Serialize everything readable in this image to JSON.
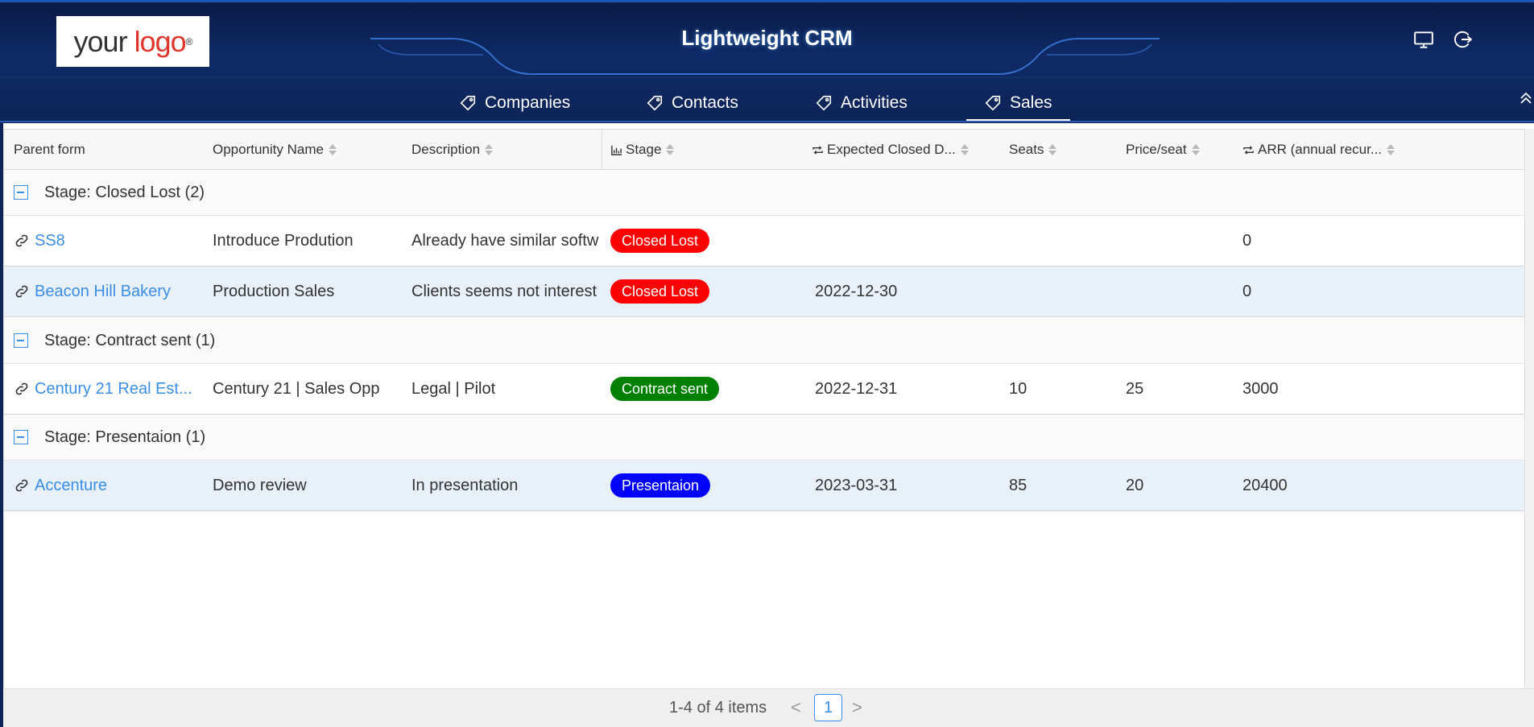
{
  "header": {
    "logo": {
      "word1": "your",
      "word2": "logo",
      "mark": "®"
    },
    "title": "Lightweight CRM",
    "icons": [
      "monitor-icon",
      "logout-icon"
    ]
  },
  "nav": {
    "tabs": [
      {
        "label": "Companies",
        "icon": "tag-icon",
        "active": false
      },
      {
        "label": "Contacts",
        "icon": "tag-icon",
        "active": false
      },
      {
        "label": "Activities",
        "icon": "tag-icon",
        "active": false
      },
      {
        "label": "Sales",
        "icon": "tag-icon",
        "active": true
      }
    ]
  },
  "grid": {
    "columns": [
      {
        "label": "Parent form",
        "sortable": false
      },
      {
        "label": "Opportunity Name",
        "sortable": true
      },
      {
        "label": "Description",
        "sortable": true
      },
      {
        "label": "Stage",
        "sortable": true,
        "icon": "bar-chart-icon"
      },
      {
        "label": "Expected Closed D...",
        "sortable": true,
        "icon": "repeat-icon"
      },
      {
        "label": "Seats",
        "sortable": true
      },
      {
        "label": "Price/seat",
        "sortable": true
      },
      {
        "label": "ARR (annual recur...",
        "sortable": true,
        "icon": "repeat-icon"
      }
    ],
    "groups": [
      {
        "label": "Stage: Closed Lost (2)",
        "rows": [
          {
            "parent": "SS8",
            "opportunity": "Introduce Prodution",
            "description": "Already have similar softw",
            "stage": "Closed Lost",
            "stage_color": "#ff0000",
            "expected_closed": "",
            "seats": "",
            "price": "",
            "arr": "0"
          },
          {
            "parent": "Beacon Hill Bakery",
            "opportunity": "Production Sales",
            "description": "Clients seems not interest",
            "stage": "Closed Lost",
            "stage_color": "#ff0000",
            "expected_closed": "2022-12-30",
            "seats": "",
            "price": "",
            "arr": "0"
          }
        ]
      },
      {
        "label": "Stage: Contract sent (1)",
        "rows": [
          {
            "parent": "Century 21 Real Est...",
            "opportunity": "Century 21 | Sales Opp",
            "description": "Legal | Pilot",
            "stage": "Contract sent",
            "stage_color": "#008000",
            "expected_closed": "2022-12-31",
            "seats": "10",
            "price": "25",
            "arr": "3000"
          }
        ]
      },
      {
        "label": "Stage: Presentaion (1)",
        "rows": [
          {
            "parent": "Accenture",
            "opportunity": "Demo review",
            "description": "In presentation",
            "stage": "Presentaion",
            "stage_color": "#0000ff",
            "expected_closed": "2023-03-31",
            "seats": "85",
            "price": "20",
            "arr": "20400"
          }
        ]
      }
    ]
  },
  "pager": {
    "summary": "1-4 of 4 items",
    "prev": "<",
    "next": ">",
    "current_page": "1"
  },
  "colors": {
    "header_bg": "#0f2a66",
    "link": "#3b8ee8",
    "row_alt": "#e8f0fa"
  }
}
